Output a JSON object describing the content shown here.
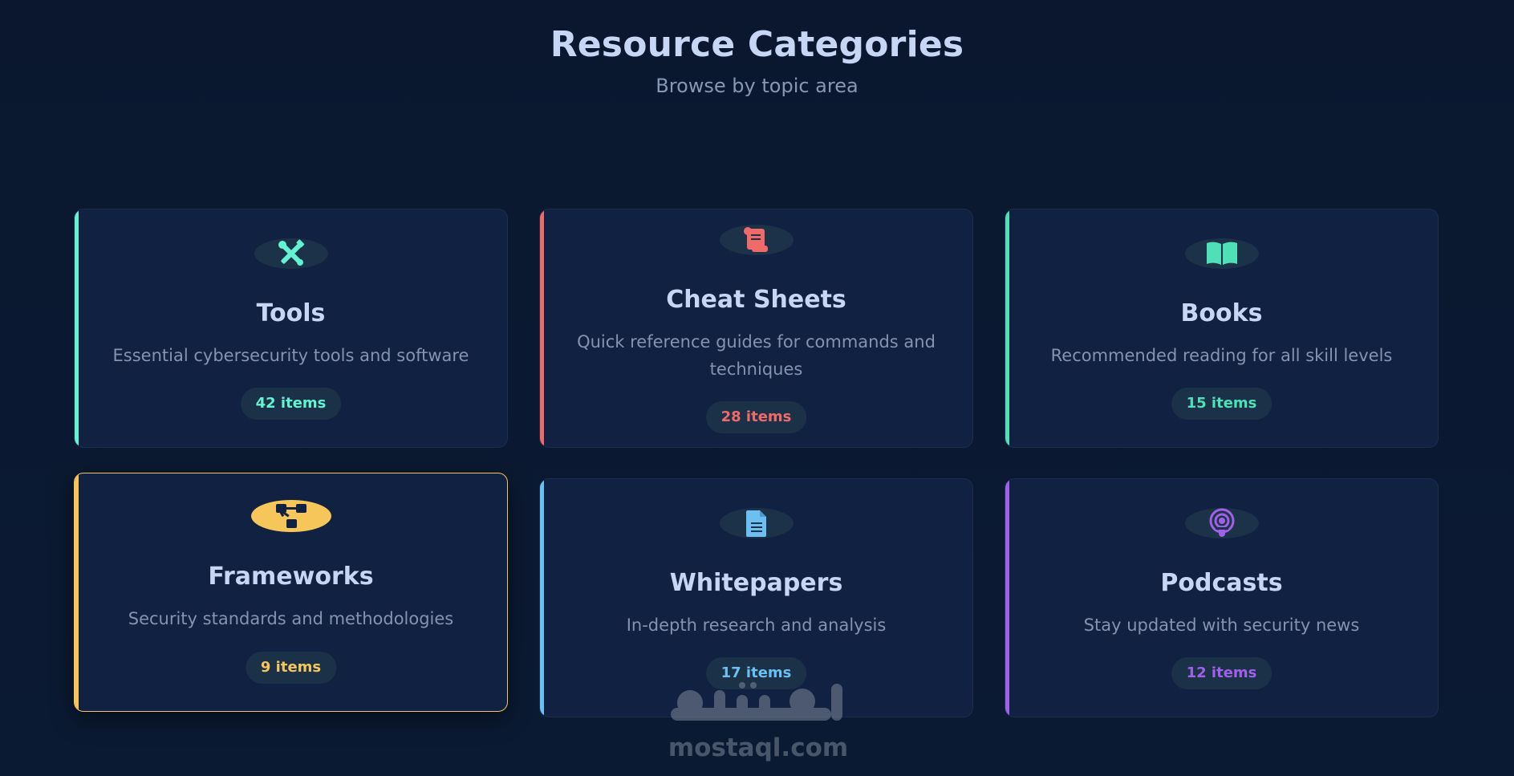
{
  "header": {
    "title": "Resource Categories",
    "subtitle": "Browse by topic area"
  },
  "cards": [
    {
      "title": "Tools",
      "description": "Essential cybersecurity tools and software",
      "count": "42 items",
      "accent": "#64f3d2",
      "icon": "tools-icon"
    },
    {
      "title": "Cheat Sheets",
      "description": "Quick reference guides for commands and techniques",
      "count": "28 items",
      "accent": "#f06a6a",
      "icon": "scroll-icon"
    },
    {
      "title": "Books",
      "description": "Recommended reading for all skill levels",
      "count": "15 items",
      "accent": "#4fe0b8",
      "icon": "book-open-icon"
    },
    {
      "title": "Frameworks",
      "description": "Security standards and methodologies",
      "count": "9 items",
      "accent": "#f7c65a",
      "icon": "sitemap-icon",
      "state": "hovered"
    },
    {
      "title": "Whitepapers",
      "description": "In-depth research and analysis",
      "count": "17 items",
      "accent": "#6cbff0",
      "icon": "file-text-icon"
    },
    {
      "title": "Podcasts",
      "description": "Stay updated with security news",
      "count": "12 items",
      "accent": "#a060e8",
      "icon": "podcast-icon"
    }
  ],
  "watermark": {
    "text": "mostaql.com",
    "logo": "mostaql-logo"
  }
}
